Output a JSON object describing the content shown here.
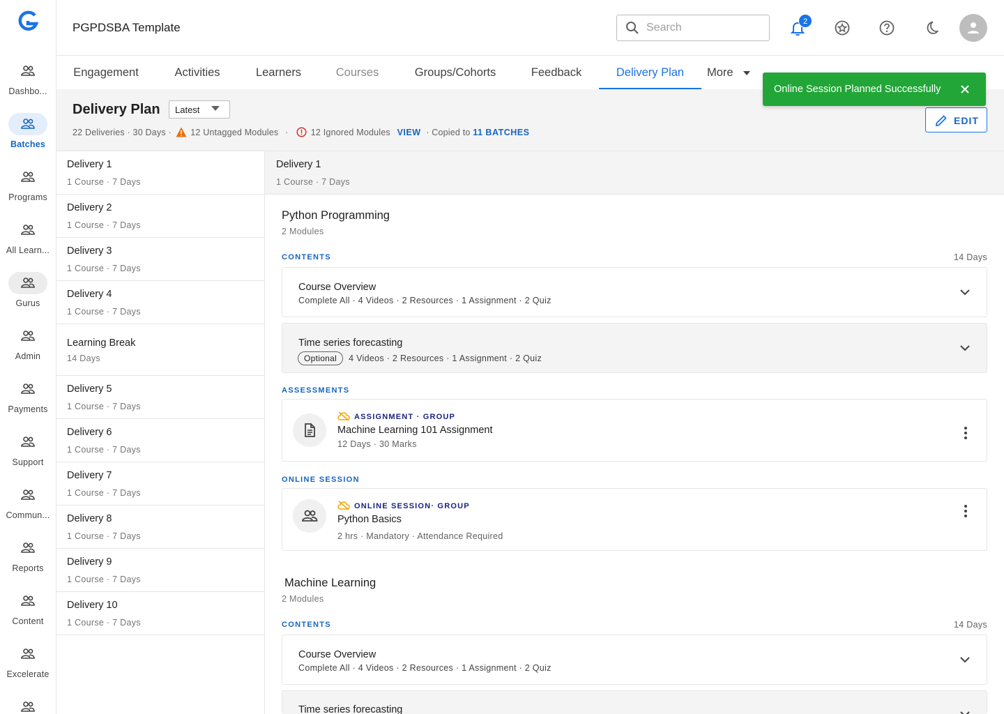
{
  "app": {
    "title": "PGPDSBA Template"
  },
  "sidebar": {
    "items": [
      {
        "label": "Dashbo..."
      },
      {
        "label": "Batches"
      },
      {
        "label": "Programs"
      },
      {
        "label": "All Learn..."
      },
      {
        "label": "Gurus"
      },
      {
        "label": "Admin"
      },
      {
        "label": "Payments"
      },
      {
        "label": "Support"
      },
      {
        "label": "Commun..."
      },
      {
        "label": "Reports"
      },
      {
        "label": "Content"
      },
      {
        "label": "Excelerate"
      }
    ]
  },
  "header": {
    "search_placeholder": "Search",
    "notification_count": "2"
  },
  "tabs": [
    {
      "label": "Engagement"
    },
    {
      "label": "Activities"
    },
    {
      "label": "Learners"
    },
    {
      "label": "Courses"
    },
    {
      "label": "Groups/Cohorts"
    },
    {
      "label": "Feedback"
    },
    {
      "label": "Delivery Plan"
    },
    {
      "label": "More"
    }
  ],
  "toast": {
    "message": "Online Session Planned Successfully"
  },
  "plan": {
    "title": "Delivery Plan",
    "version": "Latest",
    "summary": "22 Deliveries · 30 Days ·",
    "untagged": "12 Untagged Modules",
    "ignored": "12 Ignored Modules",
    "view_link": "VIEW",
    "copied_prefix": "· Copied to",
    "copied_link": "11 BATCHES",
    "edit_label": "EDIT"
  },
  "deliveries": [
    {
      "name": "Delivery 1",
      "sub": "1 Course · 7 Days"
    },
    {
      "name": "Delivery 2",
      "sub": "1 Course · 7 Days"
    },
    {
      "name": "Delivery 3",
      "sub": "1 Course · 7 Days"
    },
    {
      "name": "Delivery 4",
      "sub": "1 Course · 7 Days"
    },
    {
      "name": "Learning Break",
      "sub": "14 Days"
    },
    {
      "name": "Delivery 5",
      "sub": "1 Course · 7 Days"
    },
    {
      "name": "Delivery 6",
      "sub": "1 Course · 7 Days"
    },
    {
      "name": "Delivery 7",
      "sub": "1 Course · 7 Days"
    },
    {
      "name": "Delivery 8",
      "sub": "1 Course · 7 Days"
    },
    {
      "name": "Delivery 9",
      "sub": "1 Course · 7 Days"
    },
    {
      "name": "Delivery 10",
      "sub": "1 Course · 7 Days"
    }
  ],
  "detail": {
    "title": "Delivery 1",
    "sub": "1 Course · 7 Days",
    "courses": [
      {
        "title": "Python Programming",
        "modules": "2 Modules",
        "contents_label": "CONTENTS",
        "contents_days": "14 Days",
        "module1": {
          "title": "Course Overview",
          "sub": "Complete All · 4 Videos  · 2 Resources · 1 Assignment · 2 Quiz"
        },
        "module2": {
          "title": "Time series forecasting",
          "chip": "Optional",
          "sub": "4 Videos  · 2 Resources · 1 Assignment · 2 Quiz"
        },
        "assessments_label": "ASSESSMENTS",
        "assignment": {
          "tag": "ASSIGNMENT · GROUP",
          "title": "Machine Learning 101 Assignment",
          "sub": "12 Days · 30 Marks"
        },
        "online_label": "ONLINE SESSION",
        "session": {
          "tag": "ONLINE SESSION· GROUP",
          "title": "Python Basics",
          "sub": "2 hrs · Mandatory · Attendance Required"
        }
      },
      {
        "title": "Machine Learning",
        "modules": "2 Modules",
        "contents_label": "CONTENTS",
        "contents_days": "14 Days",
        "module1": {
          "title": "Course Overview",
          "sub": "Complete All · 4 Videos  · 2 Resources · 1 Assignment · 2 Quiz"
        },
        "module2": {
          "title": "Time series forecasting"
        }
      }
    ]
  },
  "colors": {
    "accent": "#1a73e8",
    "toast": "#21a637",
    "warning": "#e8710a",
    "error": "#d93025",
    "sync": "#f0a400"
  }
}
